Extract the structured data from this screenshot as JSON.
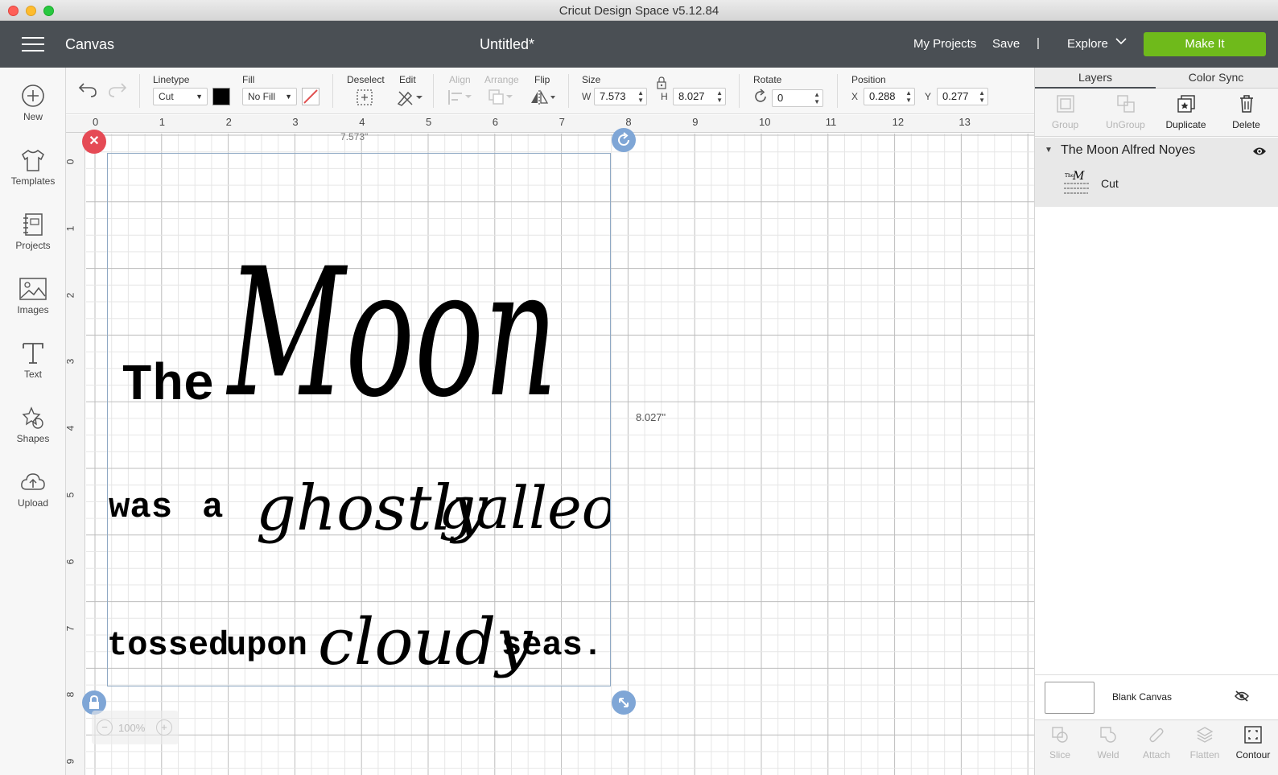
{
  "window": {
    "title": "Cricut Design Space  v5.12.84"
  },
  "header": {
    "section": "Canvas",
    "doc_title": "Untitled*",
    "my_projects": "My Projects",
    "save": "Save",
    "separator": "|",
    "explore": "Explore",
    "make_it": "Make It"
  },
  "sidebar": {
    "items": [
      {
        "label": "New",
        "icon": "plus-circle-icon"
      },
      {
        "label": "Templates",
        "icon": "tshirt-icon"
      },
      {
        "label": "Projects",
        "icon": "notebook-icon"
      },
      {
        "label": "Images",
        "icon": "image-icon"
      },
      {
        "label": "Text",
        "icon": "text-icon"
      },
      {
        "label": "Shapes",
        "icon": "shapes-icon"
      },
      {
        "label": "Upload",
        "icon": "cloud-upload-icon"
      }
    ]
  },
  "toolbar": {
    "linetype_label": "Linetype",
    "linetype_value": "Cut",
    "fill_label": "Fill",
    "fill_value": "No Fill",
    "deselect_label": "Deselect",
    "edit_label": "Edit",
    "align_label": "Align",
    "arrange_label": "Arrange",
    "flip_label": "Flip",
    "size_label": "Size",
    "w_axis": "W",
    "w_value": "7.573",
    "h_axis": "H",
    "h_value": "8.027",
    "rotate_label": "Rotate",
    "rotate_value": "0",
    "position_label": "Position",
    "x_axis": "X",
    "x_value": "0.288",
    "y_axis": "Y",
    "y_value": "0.277",
    "linetype_color": "#000000",
    "fill_swatch_color": "#e05050"
  },
  "canvas": {
    "ruler_top": [
      "0",
      "1",
      "2",
      "3",
      "4",
      "5",
      "6",
      "7",
      "8",
      "9",
      "10",
      "11",
      "12",
      "13"
    ],
    "ruler_left": [
      "0",
      "1",
      "2",
      "3",
      "4",
      "5",
      "6",
      "7",
      "8",
      "9"
    ],
    "width_label": "7.573\"",
    "height_label": "8.027\"",
    "zoom": "100%",
    "zoom_minus": "−",
    "zoom_plus": "+",
    "design_text": {
      "line1_a": "The",
      "line1_b": "Moon",
      "line2_a": "was",
      "line2_b": "a",
      "line2_c": "ghostly",
      "line2_d": "galleon",
      "line3_a": "tossed",
      "line3_b": "upon",
      "line3_c": "cloudy",
      "line3_d": "seas."
    }
  },
  "panel": {
    "tabs": [
      "Layers",
      "Color Sync"
    ],
    "actions": [
      {
        "label": "Group",
        "enabled": false
      },
      {
        "label": "UnGroup",
        "enabled": false
      },
      {
        "label": "Duplicate",
        "enabled": true
      },
      {
        "label": "Delete",
        "enabled": true
      }
    ],
    "group_name": "The Moon Alfred Noyes",
    "layer_operation": "Cut",
    "blank_canvas": "Blank Canvas",
    "bottom_actions": [
      {
        "label": "Slice",
        "enabled": false
      },
      {
        "label": "Weld",
        "enabled": false
      },
      {
        "label": "Attach",
        "enabled": false
      },
      {
        "label": "Flatten",
        "enabled": false
      },
      {
        "label": "Contour",
        "enabled": true
      }
    ]
  }
}
